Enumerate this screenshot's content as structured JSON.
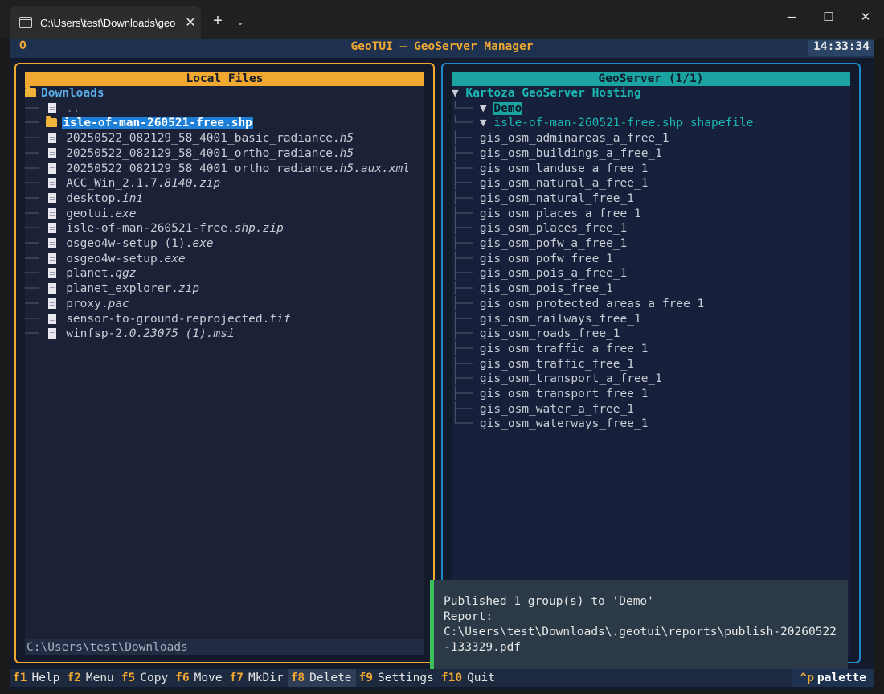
{
  "window": {
    "tab_title": "C:\\Users\\test\\Downloads\\geo",
    "tab_close": "✕",
    "new_tab": "+",
    "tab_dropdown": "⌄",
    "minimize": "─",
    "maximize": "☐",
    "close": "✕"
  },
  "header": {
    "icon": "O",
    "title": "GeoTUI — GeoServer Manager",
    "clock": "14:33:34"
  },
  "local": {
    "title": "Local Files",
    "root": "Downloads",
    "parent": "..",
    "items": [
      {
        "name": "isle-of-man-260521-free.shp",
        "ext": "",
        "type": "folder"
      },
      {
        "name": "20250522_082129_58_4001_basic_radiance.",
        "ext": "h5",
        "type": "file"
      },
      {
        "name": "20250522_082129_58_4001_ortho_radiance.",
        "ext": "h5",
        "type": "file"
      },
      {
        "name": "20250522_082129_58_4001_ortho_radiance.",
        "ext": "h5.aux.xml",
        "type": "file"
      },
      {
        "name": "ACC_Win_2.1.7.",
        "ext": "8140.zip",
        "type": "file"
      },
      {
        "name": "desktop.",
        "ext": "ini",
        "type": "file"
      },
      {
        "name": "geotui.",
        "ext": "exe",
        "type": "file"
      },
      {
        "name": "isle-of-man-260521-free.",
        "ext": "shp.zip",
        "type": "file"
      },
      {
        "name": "osgeo4w-setup (1).",
        "ext": "exe",
        "type": "file"
      },
      {
        "name": "osgeo4w-setup.",
        "ext": "exe",
        "type": "file"
      },
      {
        "name": "planet.",
        "ext": "qgz",
        "type": "file"
      },
      {
        "name": "planet_explorer.",
        "ext": "zip",
        "type": "file"
      },
      {
        "name": "proxy.",
        "ext": "pac",
        "type": "file"
      },
      {
        "name": "sensor-to-ground-reprojected.",
        "ext": "tif",
        "type": "file"
      },
      {
        "name": "winfsp-2.",
        "ext": "0.23075 (1).msi",
        "type": "file"
      }
    ],
    "path": "C:\\Users\\test\\Downloads"
  },
  "geoserver": {
    "title": "GeoServer (1/1)",
    "root": "Kartoza GeoServer Hosting",
    "workspace": "Demo",
    "store": "isle-of-man-260521-free.shp_shapefile",
    "layers": [
      "gis_osm_adminareas_a_free_1",
      "gis_osm_buildings_a_free_1",
      "gis_osm_landuse_a_free_1",
      "gis_osm_natural_a_free_1",
      "gis_osm_natural_free_1",
      "gis_osm_places_a_free_1",
      "gis_osm_places_free_1",
      "gis_osm_pofw_a_free_1",
      "gis_osm_pofw_free_1",
      "gis_osm_pois_a_free_1",
      "gis_osm_pois_free_1",
      "gis_osm_protected_areas_a_free_1",
      "gis_osm_railways_free_1",
      "gis_osm_roads_free_1",
      "gis_osm_traffic_a_free_1",
      "gis_osm_traffic_free_1",
      "gis_osm_transport_a_free_1",
      "gis_osm_transport_free_1",
      "gis_osm_water_a_free_1",
      "gis_osm_waterways_free_1"
    ]
  },
  "toast": {
    "line1": "Published 1 group(s) to 'Demo'",
    "line2": "Report:",
    "line3": "C:\\Users\\test\\Downloads\\.geotui\\reports\\publish-20260522",
    "line4": "-133329.pdf"
  },
  "footer": {
    "keys": [
      {
        "key": "f1",
        "label": "Help"
      },
      {
        "key": "f2",
        "label": "Menu"
      },
      {
        "key": "f5",
        "label": "Copy"
      },
      {
        "key": "f6",
        "label": "Move"
      },
      {
        "key": "f7",
        "label": "MkDir"
      },
      {
        "key": "f8",
        "label": "Delete"
      },
      {
        "key": "f9",
        "label": "Settings"
      },
      {
        "key": "f10",
        "label": "Quit"
      }
    ],
    "palette_key": "^p",
    "palette_label": "palette"
  }
}
